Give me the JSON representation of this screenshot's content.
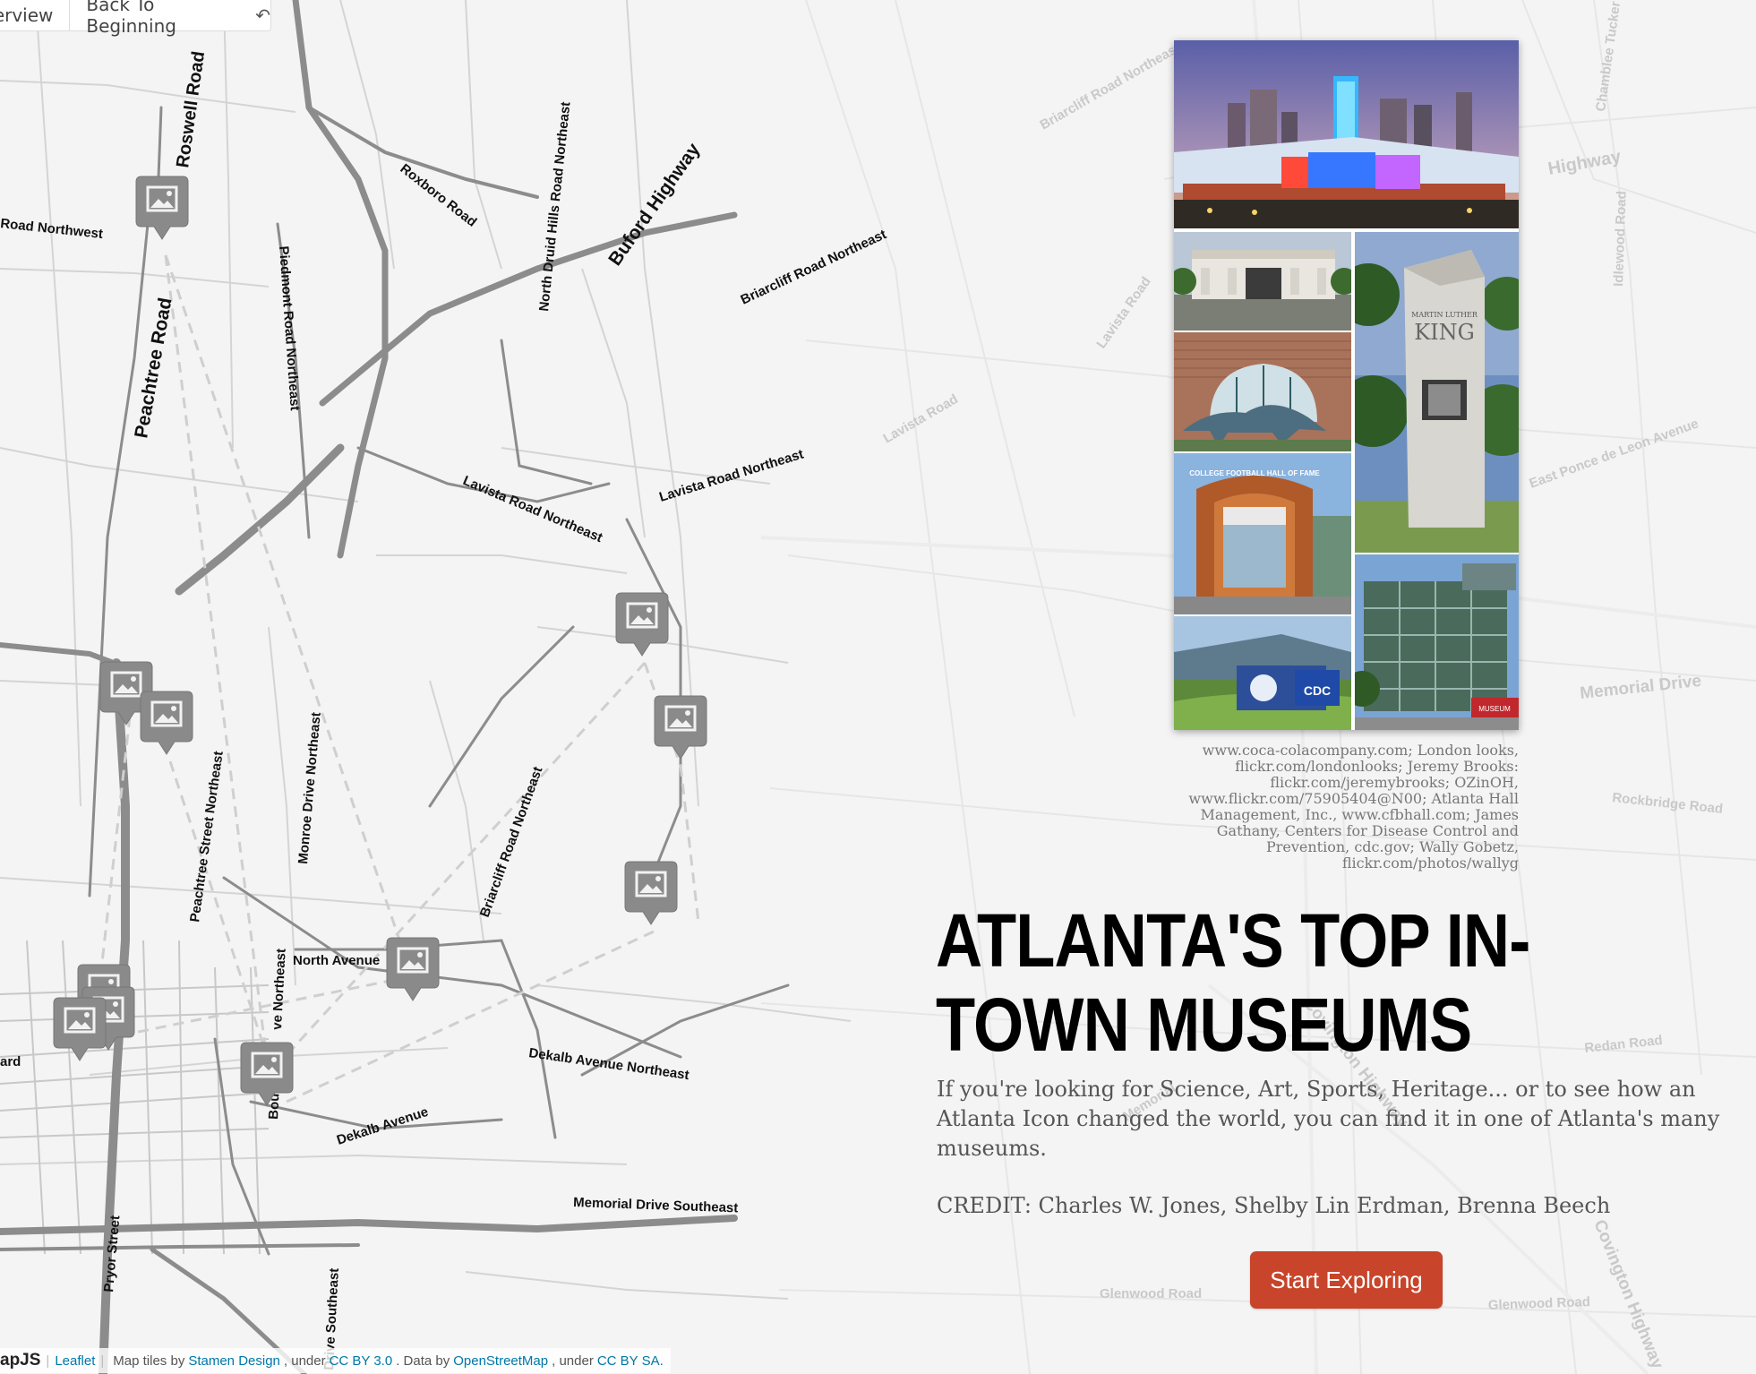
{
  "nav": {
    "overview_label": "Overview",
    "back_label": "Back To Beginning",
    "back_icon": "reply-arrow-icon"
  },
  "map": {
    "roads": {
      "roswell": "Roswell Road",
      "road_northwest": "Road Northwest",
      "roxboro": "Roxboro Road",
      "north_druid_hills": "North Druid Hills Road Northeast",
      "buford": "Buford Highway",
      "piedmont": "Piedmont Road Northeast",
      "peachtree": "Peachtree Road",
      "briarcliff_ne_top": "Briarcliff Road Northeast",
      "briarcliff_ne_right": "Briarcliff Road Northeast",
      "lavista_ne": "Lavista Road Northeast",
      "lavista_ne2": "Lavista Road Northeast",
      "lavista_faint1": "Lavista Road",
      "lavista_faint2": "Lavista Road",
      "highway": "Highway",
      "chamblee": "Chamblee Tucker",
      "idlewood": "Idlewood Road",
      "east_ponce": "East Ponce de Leon Avenue",
      "memorial_faint": "Memorial Drive",
      "rockbridge": "Rockbridge Road",
      "redan": "Redan Road",
      "glenwood1": "Glenwood Road",
      "glenwood2": "Glenwood Road",
      "covington1": "Covington Highway",
      "covington2": "Covington Highway",
      "memorial_faint2": "Memorial",
      "briarcliff_mid": "Briarcliff Road Northeast",
      "monroe": "Monroe Drive Northeast",
      "peachtree_st": "Peachtree Street Northeast",
      "north_avenue": "North Avenue",
      "dekalb_ne": "Dekalb Avenue Northeast",
      "dekalb": "Dekalb Avenue",
      "memorial_se": "Memorial Drive Southeast",
      "pryor": "Pryor Street",
      "drive_se": "Drive Southeast",
      "ve_northeast": "ve Northeast",
      "ard": "ard",
      "boul": "Boul"
    },
    "marker_icon": "image-marker-icon",
    "markers_count_label": ""
  },
  "intro": {
    "photo_credits": "www.coca-colacompany.com; London looks, flickr.com/londonlooks; Jeremy Brooks: flickr.com/jeremybrooks; OZinOH, www.flickr.com/75905404@N00; Atlanta Hall Management, Inc., www.cfbhall.com; James Gathany, Centers for Disease Control and Prevention, cdc.gov; Wally Gobetz, flickr.com/photos/wallyg",
    "title": "ATLANTA'S TOP IN-TOWN MUSEUMS",
    "description": "If you're looking for Science, Art, Sports, Heritage... or to see how an Atlanta Icon changed the world, you can find it in one of Atlanta's many museums.",
    "credit": "CREDIT: Charles W. Jones, Shelby Lin Erdman, Brenna Beech",
    "start_label": "Start Exploring",
    "collage_text": {
      "mlk_line1": "MARTIN LUTHER",
      "mlk_line2": "KING",
      "hall_of_fame": "COLLEGE FOOTBALL HALL OF FAME",
      "cdc": "CDC",
      "museum": "MUSEUM"
    }
  },
  "attribution": {
    "brand": "apJS",
    "leaflet": "Leaflet",
    "map_tiles_by": "Map tiles by",
    "stamen": "Stamen Design",
    "under1": ", under",
    "cc_by": "CC BY 3.0",
    "data_by": ". Data by",
    "osm": "OpenStreetMap",
    "under2": ", under",
    "cc_by_sa": "CC BY SA."
  },
  "colors": {
    "button": "#c8442a",
    "marker": "#8a8a8a",
    "road": "#8c8c8c"
  }
}
